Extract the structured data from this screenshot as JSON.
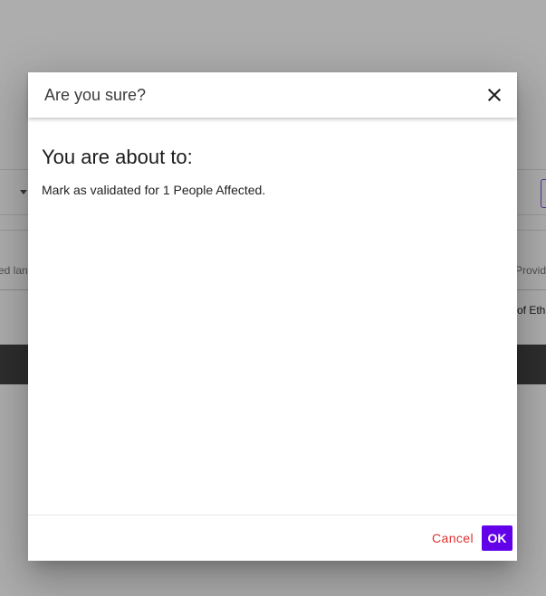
{
  "background": {
    "column_left_label": "ed lang",
    "column_right_label": "Provide",
    "row_right_text": "of Ethi"
  },
  "dialog": {
    "title": "Are you sure?",
    "close_icon": "close-icon",
    "heading": "You are about to:",
    "message": "Mark as validated for 1 People Affected.",
    "cancel_label": "Cancel",
    "ok_label": "OK"
  },
  "colors": {
    "primary": "#6200ea",
    "cancel": "#e0322f",
    "overlay": "rgba(0,0,0,0.32)"
  }
}
